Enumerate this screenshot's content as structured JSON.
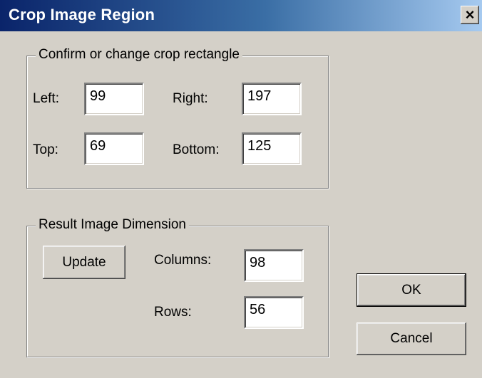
{
  "window": {
    "title": "Crop Image Region",
    "close_label": "×"
  },
  "crop_group": {
    "legend": "Confirm or change crop rectangle",
    "left_label": "Left:",
    "left_value": "99",
    "right_label": "Right:",
    "right_value": "197",
    "top_label": "Top:",
    "top_value": "69",
    "bottom_label": "Bottom:",
    "bottom_value": "125"
  },
  "result_group": {
    "legend": "Result Image Dimension",
    "update_label": "Update",
    "columns_label": "Columns:",
    "columns_value": "98",
    "rows_label": "Rows:",
    "rows_value": "56"
  },
  "actions": {
    "ok_label": "OK",
    "cancel_label": "Cancel"
  }
}
